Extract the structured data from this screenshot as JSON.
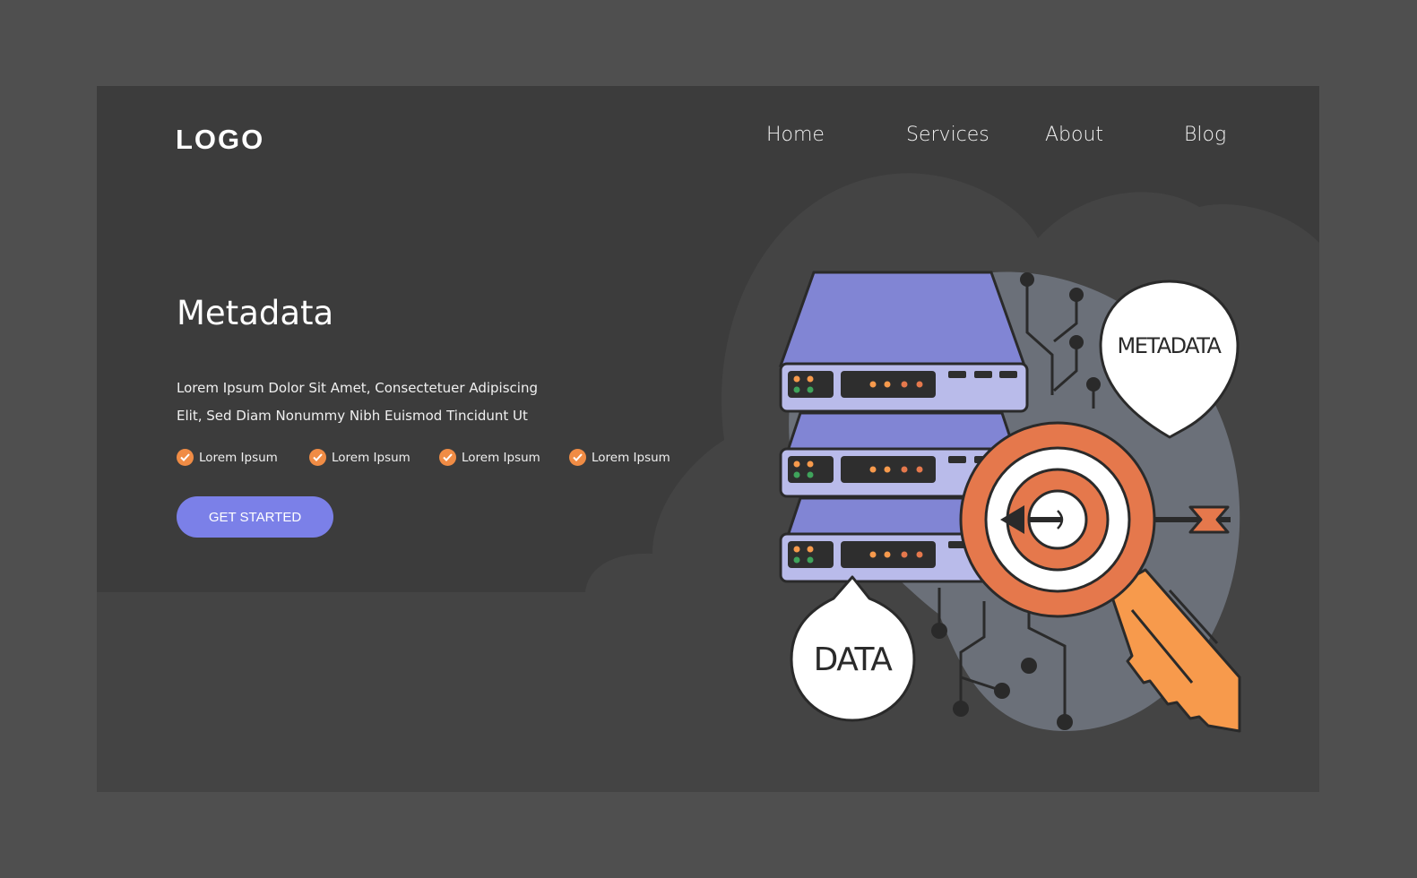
{
  "header": {
    "logo": "LOGO",
    "nav": [
      {
        "label": "Home"
      },
      {
        "label": "Services"
      },
      {
        "label": "About"
      },
      {
        "label": "Blog"
      }
    ]
  },
  "hero": {
    "title": "Metadata",
    "description": "Lorem Ipsum Dolor Sit Amet, Consectetuer Adipiscing Elit, Sed Diam Nonummy Nibh Euismod Tincidunt Ut",
    "features": [
      {
        "label": "Lorem Ipsum",
        "icon": "check-circle-icon"
      },
      {
        "label": "Lorem Ipsum",
        "icon": "check-circle-icon"
      },
      {
        "label": "Lorem Ipsum",
        "icon": "check-circle-icon"
      },
      {
        "label": "Lorem Ipsum",
        "icon": "check-circle-icon"
      }
    ],
    "cta_label": "GET STARTED"
  },
  "illustration": {
    "bubble_metadata": "METADATA",
    "bubble_data": "DATA",
    "icons": [
      "server-stack-icon",
      "target-icon",
      "arrow-icon",
      "key-icon",
      "circuit-icon"
    ]
  },
  "colors": {
    "page_bg": "#4f4f4f",
    "card_bg": "#3c3c3c",
    "cloud": "#444444",
    "accent_button": "#7b80e8",
    "check_orange": "#f08c45",
    "server_top": "#8185d4",
    "server_front": "#b9bbea",
    "target_orange": "#e5784c",
    "key_orange": "#f79a4c",
    "circuit_bg": "#6b7079"
  }
}
